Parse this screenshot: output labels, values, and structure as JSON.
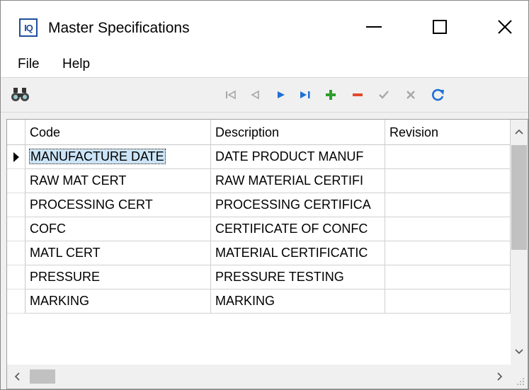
{
  "window": {
    "title": "Master Specifications",
    "icon_text": "IQ"
  },
  "menu": {
    "file": "File",
    "help": "Help"
  },
  "toolbar": {
    "buttons": [
      {
        "name": "find-icon",
        "enabled": true
      },
      {
        "name": "first-record-icon",
        "enabled": false
      },
      {
        "name": "prior-record-icon",
        "enabled": false
      },
      {
        "name": "next-record-icon",
        "enabled": true
      },
      {
        "name": "last-record-icon",
        "enabled": true
      },
      {
        "name": "insert-record-icon",
        "enabled": true
      },
      {
        "name": "delete-record-icon",
        "enabled": true
      },
      {
        "name": "post-edit-icon",
        "enabled": false
      },
      {
        "name": "cancel-edit-icon",
        "enabled": false
      },
      {
        "name": "refresh-icon",
        "enabled": true
      }
    ],
    "colors": {
      "nav": "#1f6fd6",
      "disabled": "#a8a8a8",
      "insert": "#2e9e2e",
      "delete": "#e34a2a",
      "refresh": "#1f6fd6"
    }
  },
  "grid": {
    "columns": [
      "Code",
      "Description",
      "Revision"
    ],
    "rows": [
      {
        "code": "MANUFACTURE DATE",
        "description": "DATE PRODUCT MANUF",
        "revision": ""
      },
      {
        "code": "RAW MAT CERT",
        "description": "RAW MATERIAL CERTIFI",
        "revision": ""
      },
      {
        "code": "PROCESSING CERT",
        "description": "PROCESSING CERTIFICA",
        "revision": ""
      },
      {
        "code": "COFC",
        "description": "CERTIFICATE OF CONFC",
        "revision": ""
      },
      {
        "code": "MATL CERT",
        "description": "MATERIAL CERTIFICATIC",
        "revision": ""
      },
      {
        "code": "PRESSURE",
        "description": "PRESSURE TESTING",
        "revision": ""
      },
      {
        "code": "MARKING",
        "description": "MARKING",
        "revision": ""
      }
    ],
    "selected_row": 0,
    "selection_color": "#cce4f7"
  }
}
